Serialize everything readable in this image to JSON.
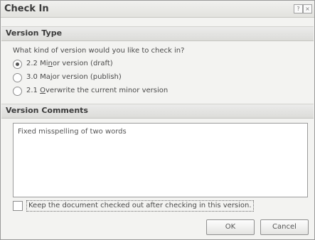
{
  "window": {
    "title": "Check In"
  },
  "version_type": {
    "header": "Version Type",
    "question": "What kind of version would you like to check in?",
    "options": [
      {
        "pre": "2.2 Mi",
        "mnemonic": "n",
        "post": "or version (draft)",
        "checked": true
      },
      {
        "pre": "3.0 Ma",
        "mnemonic": "j",
        "post": "or version (publish)",
        "checked": false
      },
      {
        "pre": "2.1 ",
        "mnemonic": "O",
        "post": "verwrite the current minor version",
        "checked": false
      }
    ]
  },
  "version_comments": {
    "header": "Version Comments",
    "text": "Fixed misspelling of two words"
  },
  "keep_checked_out": {
    "label": "Keep the document checked out after checking in this version.",
    "checked": false
  },
  "buttons": {
    "ok": "OK",
    "cancel": "Cancel"
  },
  "titlebar_buttons": {
    "help": "?",
    "close": "×"
  }
}
